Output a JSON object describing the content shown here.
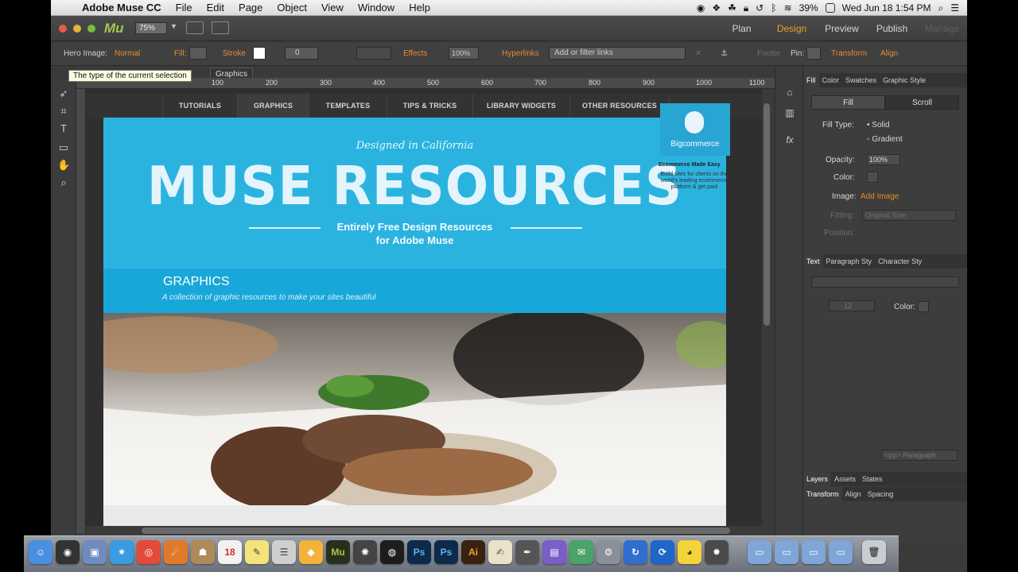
{
  "menubar": {
    "app": "Adobe Muse CC",
    "items": [
      "File",
      "Edit",
      "Page",
      "Object",
      "View",
      "Window",
      "Help"
    ],
    "battery": "39%",
    "datetime": "Wed Jun 18  1:54 PM"
  },
  "appbar": {
    "logo": "Mu",
    "zoom": "75%",
    "modes": [
      "Plan",
      "Design",
      "Preview",
      "Publish",
      "Manage"
    ],
    "active_mode": "Design"
  },
  "control": {
    "selection_label": "Hero Image:",
    "selection_value": "Normal",
    "fill_label": "Fill:",
    "stroke_label": "Stroke",
    "stroke_value": "0",
    "effects_label": "Effects",
    "opacity_value": "100%",
    "hyperlinks_label": "Hyperlinks",
    "hyperlinks_placeholder": "Add or filter links",
    "footer_label": "Footer",
    "pin_label": "Pin:",
    "transform_label": "Transform",
    "align_label": "Align"
  },
  "tooltip": "The type of the current selection",
  "page_tab": "Graphics",
  "ruler": [
    "100",
    "200",
    "300",
    "400",
    "500",
    "600",
    "700",
    "800",
    "900",
    "1000",
    "1100"
  ],
  "site": {
    "nav": [
      "TUTORIALS",
      "GRAPHICS",
      "TEMPLATES",
      "TIPS & TRICKS",
      "LIBRARY WIDGETS",
      "OTHER RESOURCES"
    ],
    "tagline": "Designed in California",
    "title": "MUSE RESOURCES",
    "subtitle_line1": "Entirely Free Design Resources",
    "subtitle_line2": "for Adobe Muse",
    "section_title": "GRAPHICS",
    "section_sub": "A collection of graphic resources to make your sites beautiful",
    "ad_label": "Bigcommerce",
    "ad_heading": "Ecommerce Made Easy",
    "ad_body": "Build sites for clients on the world's leading ecommerce platform & get paid"
  },
  "panel": {
    "tabs": [
      "Fill",
      "Color",
      "Swatches",
      "Graphic Style"
    ],
    "segments": [
      "Fill",
      "Scroll"
    ],
    "fill_type_label": "Fill Type:",
    "fill_solid": "Solid",
    "fill_gradient": "Gradient",
    "opacity_label": "Opacity:",
    "opacity_value": "100%",
    "color_label": "Color:",
    "image_label": "Image:",
    "add_image": "Add Image",
    "fitting_label": "Fitting:",
    "fitting_value": "Original Size",
    "position_label": "Position:",
    "text_tabs": [
      "Text",
      "Paragraph Sty",
      "Character Sty"
    ],
    "text_color_label": "Color:",
    "text_size": "12",
    "paragraph_placeholder": "<pp> Paragraph",
    "bottom_tabs": [
      "Layers",
      "Assets",
      "States"
    ],
    "bottom_tabs2": [
      "Transform",
      "Align",
      "Spacing"
    ]
  },
  "dock": {
    "apps": [
      "Finder",
      "Dashboard",
      "Preview",
      "Safari",
      "Chrome",
      "Firefox",
      "Contacts",
      "Calendar",
      "Stickies",
      "Notes",
      "Sketch",
      "Muse",
      "Aperture",
      "DVD",
      "Photoshop",
      "Photoshop CC",
      "Illustrator",
      "Script Editor",
      "Pen",
      "Charts",
      "Maps",
      "Preferences",
      "Sync",
      "Adium",
      "Gear",
      "Folder",
      "Folder",
      "Folder",
      "Folder",
      "Trash"
    ],
    "calendar_day": "18"
  },
  "colors": {
    "accent_orange": "#f29a2e",
    "hero_blue": "#2bb3e0",
    "band_blue": "#18a7d9"
  }
}
